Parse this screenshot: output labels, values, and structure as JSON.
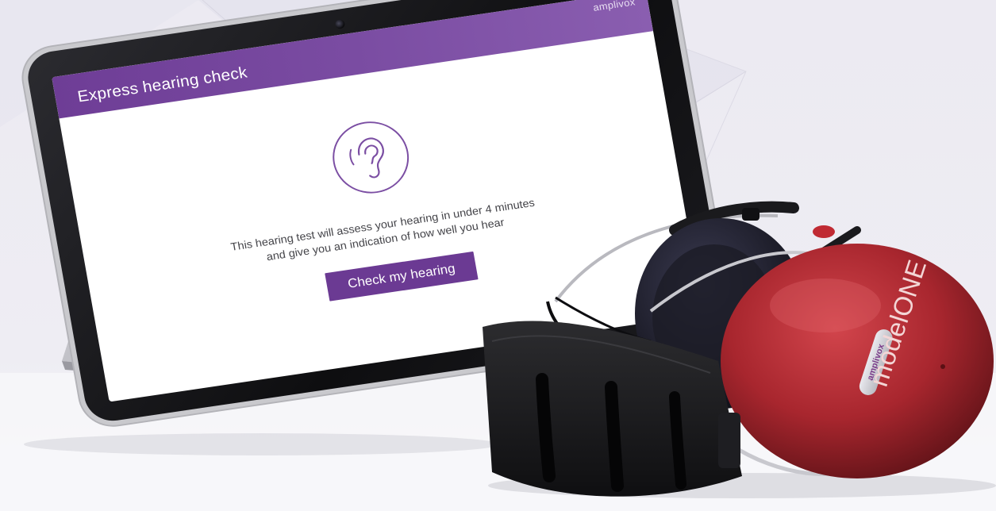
{
  "tablet": {
    "header_title": "Express hearing check",
    "brand": "amplivox",
    "intro_line_1": "This hearing test will assess your hearing in under 4 minutes",
    "intro_line_2": "and give you an indication of how well you hear",
    "button_label": "Check my hearing",
    "accent_color": "#6b3a93"
  },
  "headphones": {
    "model_label": "modelONE",
    "badge_text": "amplivox",
    "shell_color": "#a8262e"
  },
  "icons": [
    "ear-icon",
    "camera-icon"
  ]
}
